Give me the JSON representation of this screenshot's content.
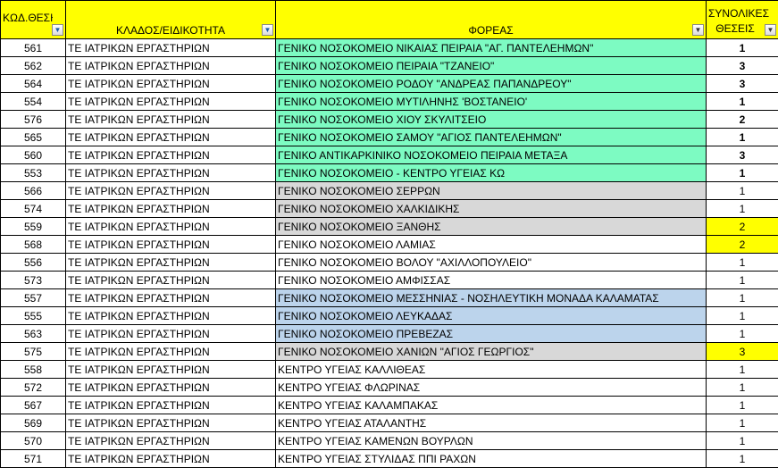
{
  "headers": {
    "code": "ΚΩΔ.ΘΕΣΗΣ",
    "branch": "ΚΛΑΔΟΣ/ΕΙΔΙΚΟΤΗΤΑ",
    "agency": "ΦΟΡΕΑΣ",
    "total_line1": "ΣΥΝΟΛΙΚΕΣ",
    "total_line2": "ΘΕΣΕΙΣ"
  },
  "filter_icons": {
    "code": "funnel-filter-icon",
    "branch": "funnel-filter-icon",
    "agency": "dropdown-arrow-icon",
    "total": "dropdown-arrow-icon"
  },
  "colors": {
    "header_bg": "#ffff00",
    "green": "#7dfbc2",
    "gray": "#d8d8d8",
    "blue": "#bcd4ec",
    "yellow": "#ffff00"
  },
  "rows": [
    {
      "code": "561",
      "branch": "ΤΕ ΙΑΤΡΙΚΩΝ ΕΡΓΑΣΤΗΡΙΩΝ",
      "agency": "ΓΕΝΙΚΟ ΝΟΣΟΚΟΜΕΙΟ ΝΙΚΑΙΑΣ ΠΕΙΡΑΙΑ \"ΑΓ. ΠΑΝΤΕΛΕΗΜΩΝ\"",
      "total": "1",
      "agency_color": "green",
      "total_color": "",
      "bold": true
    },
    {
      "code": "562",
      "branch": "ΤΕ ΙΑΤΡΙΚΩΝ ΕΡΓΑΣΤΗΡΙΩΝ",
      "agency": "ΓΕΝΙΚΟ ΝΟΣΟΚΟΜΕΙΟ ΠΕΙΡΑΙΑ \"ΤΖΑΝΕΙΟ\"",
      "total": "3",
      "agency_color": "green",
      "total_color": "",
      "bold": true
    },
    {
      "code": "564",
      "branch": "ΤΕ ΙΑΤΡΙΚΩΝ ΕΡΓΑΣΤΗΡΙΩΝ",
      "agency": "ΓΕΝΙΚΟ ΝΟΣΟΚΟΜΕΙΟ ΡΟΔΟΥ \"ΑΝΔΡΕΑΣ ΠΑΠΑΝΔΡΕΟΥ\"",
      "total": "3",
      "agency_color": "green",
      "total_color": "",
      "bold": true
    },
    {
      "code": "554",
      "branch": "ΤΕ ΙΑΤΡΙΚΩΝ ΕΡΓΑΣΤΗΡΙΩΝ",
      "agency": "ΓΕΝΙΚΟ ΝΟΣΟΚΟΜΕΙΟ ΜΥΤΙΛΗΝΗΣ 'ΒΟΣΤΑΝΕΙΟ'",
      "total": "1",
      "agency_color": "green",
      "total_color": "",
      "bold": true
    },
    {
      "code": "576",
      "branch": "ΤΕ ΙΑΤΡΙΚΩΝ ΕΡΓΑΣΤΗΡΙΩΝ",
      "agency": "ΓΕΝΙΚΟ ΝΟΣΟΚΟΜΕΙΟ ΧΙΟΥ ΣΚΥΛΙΤΣΕΙΟ",
      "total": "2",
      "agency_color": "green",
      "total_color": "",
      "bold": true
    },
    {
      "code": "565",
      "branch": "ΤΕ ΙΑΤΡΙΚΩΝ ΕΡΓΑΣΤΗΡΙΩΝ",
      "agency": "ΓΕΝΙΚΟ ΝΟΣΟΚΟΜΕΙΟ ΣΑΜΟΥ \"ΑΓΙΟΣ ΠΑΝΤΕΛΕΗΜΩΝ\"",
      "total": "1",
      "agency_color": "green",
      "total_color": "",
      "bold": true
    },
    {
      "code": "560",
      "branch": "ΤΕ ΙΑΤΡΙΚΩΝ ΕΡΓΑΣΤΗΡΙΩΝ",
      "agency": "ΓΕΝΙΚΟ ΑΝΤΙΚΑΡΚΙΝΙΚΟ ΝΟΣΟΚΟΜΕΙΟ ΠΕΙΡΑΙΑ ΜΕΤΑΞΑ",
      "total": "3",
      "agency_color": "green",
      "total_color": "",
      "bold": true
    },
    {
      "code": "553",
      "branch": "ΤΕ ΙΑΤΡΙΚΩΝ ΕΡΓΑΣΤΗΡΙΩΝ",
      "agency": "ΓΕΝΙΚΟ ΝΟΣΟΚΟΜΕΙΟ - ΚΕΝΤΡΟ ΥΓΕΙΑΣ ΚΩ",
      "total": "1",
      "agency_color": "green",
      "total_color": "",
      "bold": true
    },
    {
      "code": "566",
      "branch": "ΤΕ ΙΑΤΡΙΚΩΝ ΕΡΓΑΣΤΗΡΙΩΝ",
      "agency": "ΓΕΝΙΚΟ ΝΟΣΟΚΟΜΕΙΟ ΣΕΡΡΩΝ",
      "total": "1",
      "agency_color": "gray",
      "total_color": "",
      "bold": false
    },
    {
      "code": "574",
      "branch": "ΤΕ ΙΑΤΡΙΚΩΝ ΕΡΓΑΣΤΗΡΙΩΝ",
      "agency": "ΓΕΝΙΚΟ ΝΟΣΟΚΟΜΕΙΟ ΧΑΛΚΙΔΙΚΗΣ",
      "total": "1",
      "agency_color": "gray",
      "total_color": "",
      "bold": false
    },
    {
      "code": "559",
      "branch": "ΤΕ ΙΑΤΡΙΚΩΝ ΕΡΓΑΣΤΗΡΙΩΝ",
      "agency": "ΓΕΝΙΚΟ ΝΟΣΟΚΟΜΕΙΟ ΞΑΝΘΗΣ",
      "total": "2",
      "agency_color": "gray",
      "total_color": "yellow",
      "bold": false
    },
    {
      "code": "568",
      "branch": "ΤΕ ΙΑΤΡΙΚΩΝ ΕΡΓΑΣΤΗΡΙΩΝ",
      "agency": "ΓΕΝΙΚΟ ΝΟΣΟΚΟΜΕΙΟ ΛΑΜΙΑΣ",
      "total": "2",
      "agency_color": "",
      "total_color": "yellow",
      "bold": false
    },
    {
      "code": "556",
      "branch": "ΤΕ ΙΑΤΡΙΚΩΝ ΕΡΓΑΣΤΗΡΙΩΝ",
      "agency": "ΓΕΝΙΚΟ ΝΟΣΟΚΟΜΕΙΟ ΒΟΛΟΥ \"ΑΧΙΛΛΟΠΟΥΛΕΙΟ\"",
      "total": "1",
      "agency_color": "",
      "total_color": "",
      "bold": false
    },
    {
      "code": "573",
      "branch": "ΤΕ ΙΑΤΡΙΚΩΝ ΕΡΓΑΣΤΗΡΙΩΝ",
      "agency": "ΓΕΝΙΚΟ ΝΟΣΟΚΟΜΕΙΟ ΑΜΦΙΣΣΑΣ",
      "total": "1",
      "agency_color": "",
      "total_color": "",
      "bold": false
    },
    {
      "code": "557",
      "branch": "ΤΕ ΙΑΤΡΙΚΩΝ ΕΡΓΑΣΤΗΡΙΩΝ",
      "agency": "ΓΕΝΙΚΟ ΝΟΣΟΚΟΜΕΙΟ ΜΕΣΣΗΝΙΑΣ - ΝΟΣΗΛΕΥΤΙΚΗ ΜΟΝΑΔΑ ΚΑΛΑΜΑΤΑΣ",
      "total": "1",
      "agency_color": "blue",
      "total_color": "",
      "bold": false
    },
    {
      "code": "555",
      "branch": "ΤΕ ΙΑΤΡΙΚΩΝ ΕΡΓΑΣΤΗΡΙΩΝ",
      "agency": "ΓΕΝΙΚΟ ΝΟΣΟΚΟΜΕΙΟ ΛΕΥΚΑΔΑΣ",
      "total": "1",
      "agency_color": "blue",
      "total_color": "",
      "bold": false
    },
    {
      "code": "563",
      "branch": "ΤΕ ΙΑΤΡΙΚΩΝ ΕΡΓΑΣΤΗΡΙΩΝ",
      "agency": "ΓΕΝΙΚΟ ΝΟΣΟΚΟΜΕΙΟ ΠΡΕΒΕΖΑΣ",
      "total": "1",
      "agency_color": "blue",
      "total_color": "",
      "bold": false
    },
    {
      "code": "575",
      "branch": "ΤΕ ΙΑΤΡΙΚΩΝ ΕΡΓΑΣΤΗΡΙΩΝ",
      "agency": "ΓΕΝΙΚΟ ΝΟΣΟΚΟΜΕΙΟ ΧΑΝΙΩΝ \"ΑΓΙΟΣ ΓΕΩΡΓΙΟΣ\"",
      "total": "3",
      "agency_color": "gray",
      "total_color": "yellow",
      "bold": false
    },
    {
      "code": "558",
      "branch": "ΤΕ ΙΑΤΡΙΚΩΝ ΕΡΓΑΣΤΗΡΙΩΝ",
      "agency": "ΚΕΝΤΡΟ ΥΓΕΙΑΣ ΚΑΛΛΙΘΕΑΣ",
      "total": "1",
      "agency_color": "",
      "total_color": "",
      "bold": false
    },
    {
      "code": "572",
      "branch": "ΤΕ ΙΑΤΡΙΚΩΝ ΕΡΓΑΣΤΗΡΙΩΝ",
      "agency": "ΚΕΝΤΡΟ ΥΓΕΙΑΣ ΦΛΩΡΙΝΑΣ",
      "total": "1",
      "agency_color": "",
      "total_color": "",
      "bold": false
    },
    {
      "code": "567",
      "branch": "ΤΕ ΙΑΤΡΙΚΩΝ ΕΡΓΑΣΤΗΡΙΩΝ",
      "agency": "ΚΕΝΤΡΟ ΥΓΕΙΑΣ ΚΑΛΑΜΠΑΚΑΣ",
      "total": "1",
      "agency_color": "",
      "total_color": "",
      "bold": false
    },
    {
      "code": "569",
      "branch": "ΤΕ ΙΑΤΡΙΚΩΝ ΕΡΓΑΣΤΗΡΙΩΝ",
      "agency": "ΚΕΝΤΡΟ ΥΓΕΙΑΣ ΑΤΑΛΑΝΤΗΣ",
      "total": "1",
      "agency_color": "",
      "total_color": "",
      "bold": false
    },
    {
      "code": "570",
      "branch": "ΤΕ ΙΑΤΡΙΚΩΝ ΕΡΓΑΣΤΗΡΙΩΝ",
      "agency": "ΚΕΝΤΡΟ ΥΓΕΙΑΣ ΚΑΜΕΝΩΝ ΒΟΥΡΛΩΝ",
      "total": "1",
      "agency_color": "",
      "total_color": "",
      "bold": false
    },
    {
      "code": "571",
      "branch": "ΤΕ ΙΑΤΡΙΚΩΝ ΕΡΓΑΣΤΗΡΙΩΝ",
      "agency": "ΚΕΝΤΡΟ ΥΓΕΙΑΣ ΣΤΥΛΙΔΑΣ ΠΠΙ ΡΑΧΩΝ",
      "total": "1",
      "agency_color": "",
      "total_color": "",
      "bold": false
    }
  ]
}
